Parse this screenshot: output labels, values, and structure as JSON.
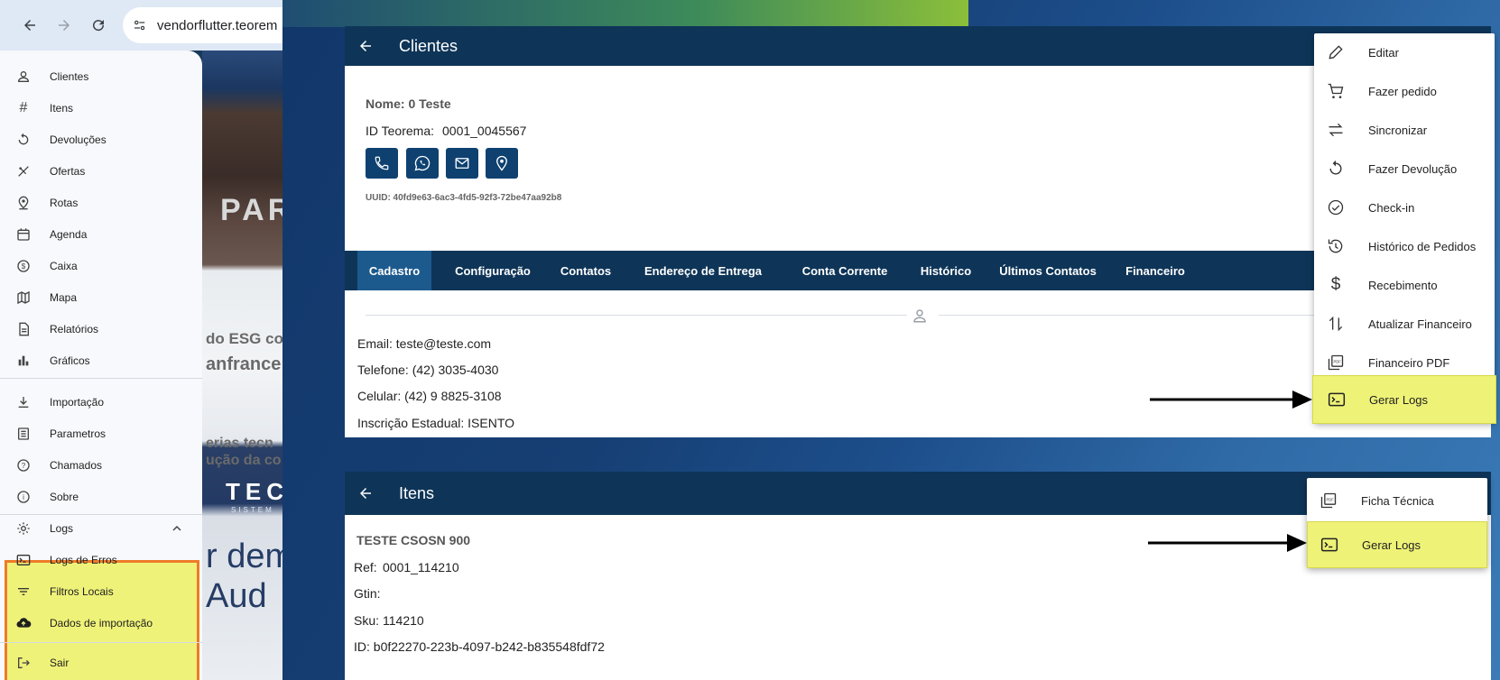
{
  "browser": {
    "url": "vendorflutter.teorem"
  },
  "background_text": {
    "line1": "PARA",
    "line2": "do ESG co",
    "line3": "anfrance",
    "line4": "erias tecn",
    "line5": "ução da co",
    "line6": "TEC",
    "line7": "SISTEM",
    "line8": "r dem",
    "line9": "Aud"
  },
  "drawer": {
    "items": [
      {
        "label": "Clientes",
        "icon": "person-icon"
      },
      {
        "label": "Itens",
        "icon": "hash-icon"
      },
      {
        "label": "Devoluções",
        "icon": "return-icon"
      },
      {
        "label": "Ofertas",
        "icon": "offer-icon"
      },
      {
        "label": "Rotas",
        "icon": "map-pin-icon"
      },
      {
        "label": "Agenda",
        "icon": "calendar-icon"
      },
      {
        "label": "Caixa",
        "icon": "dollar-icon"
      },
      {
        "label": "Mapa",
        "icon": "map-icon"
      },
      {
        "label": "Relatórios",
        "icon": "report-icon"
      },
      {
        "label": "Gráficos",
        "icon": "bar-chart-icon"
      },
      {
        "label": "Importação",
        "icon": "download-icon"
      },
      {
        "label": "Parametros",
        "icon": "list-icon"
      },
      {
        "label": "Chamados",
        "icon": "help-icon"
      },
      {
        "label": "Sobre",
        "icon": "info-icon"
      },
      {
        "label": "Logs",
        "icon": "gear-icon"
      },
      {
        "label": "Logs de Erros",
        "icon": "terminal-icon"
      },
      {
        "label": "Filtros Locais",
        "icon": "filter-icon"
      },
      {
        "label": "Dados de importação",
        "icon": "cloud-upload-icon"
      },
      {
        "label": "Sair",
        "icon": "logout-icon"
      }
    ]
  },
  "clientes": {
    "title": "Clientes",
    "nome": "Nome: 0 Teste",
    "id_label": "ID Teorema:",
    "id_value": "0001_0045567",
    "uuid": "UUID: 40fd9e63-6ac3-4fd5-92f3-72be47aa92b8",
    "tabs": [
      "Cadastro",
      "Configuração",
      "Contatos",
      "Endereço de Entrega",
      "Conta Corrente",
      "Histórico",
      "Últimos Contatos",
      "Financeiro"
    ],
    "email": "Email: teste@teste.com",
    "telefone": "Telefone: (42) 3035-4030",
    "celular": "Celular: (42) 9 8825-3108",
    "inscricao": "Inscrição Estadual: ISENTO"
  },
  "clientes_menu": {
    "items": [
      {
        "label": "Editar",
        "icon": "pencil-icon"
      },
      {
        "label": "Fazer pedido",
        "icon": "cart-icon"
      },
      {
        "label": "Sincronizar",
        "icon": "sync-arrows-icon"
      },
      {
        "label": "Fazer Devolução",
        "icon": "return-icon"
      },
      {
        "label": "Check-in",
        "icon": "check-circle-icon"
      },
      {
        "label": "Histórico de Pedidos",
        "icon": "history-icon"
      },
      {
        "label": "Recebimento",
        "icon": "dollar-icon"
      },
      {
        "label": "Atualizar Financeiro",
        "icon": "swap-vertical-icon"
      },
      {
        "label": "Financeiro PDF",
        "icon": "pdf-icon"
      },
      {
        "label": "Gerar Logs",
        "icon": "terminal-icon"
      }
    ]
  },
  "itens": {
    "title": "Itens",
    "name": "TESTE CSOSN 900",
    "ref_label": "Ref:",
    "ref_value": "0001_114210",
    "gtin": "Gtin:",
    "sku_label": "Sku:",
    "sku_value": "114210",
    "id": "ID: b0f22270-223b-4097-b242-b835548fdf72"
  },
  "itens_menu": {
    "items": [
      {
        "label": "Ficha Técnica",
        "icon": "pdf-icon"
      },
      {
        "label": "Gerar Logs",
        "icon": "terminal-icon"
      }
    ]
  },
  "colors": {
    "appbar": "#0e3558",
    "highlight": "#eef277",
    "highlight_border": "#ee7b28"
  }
}
